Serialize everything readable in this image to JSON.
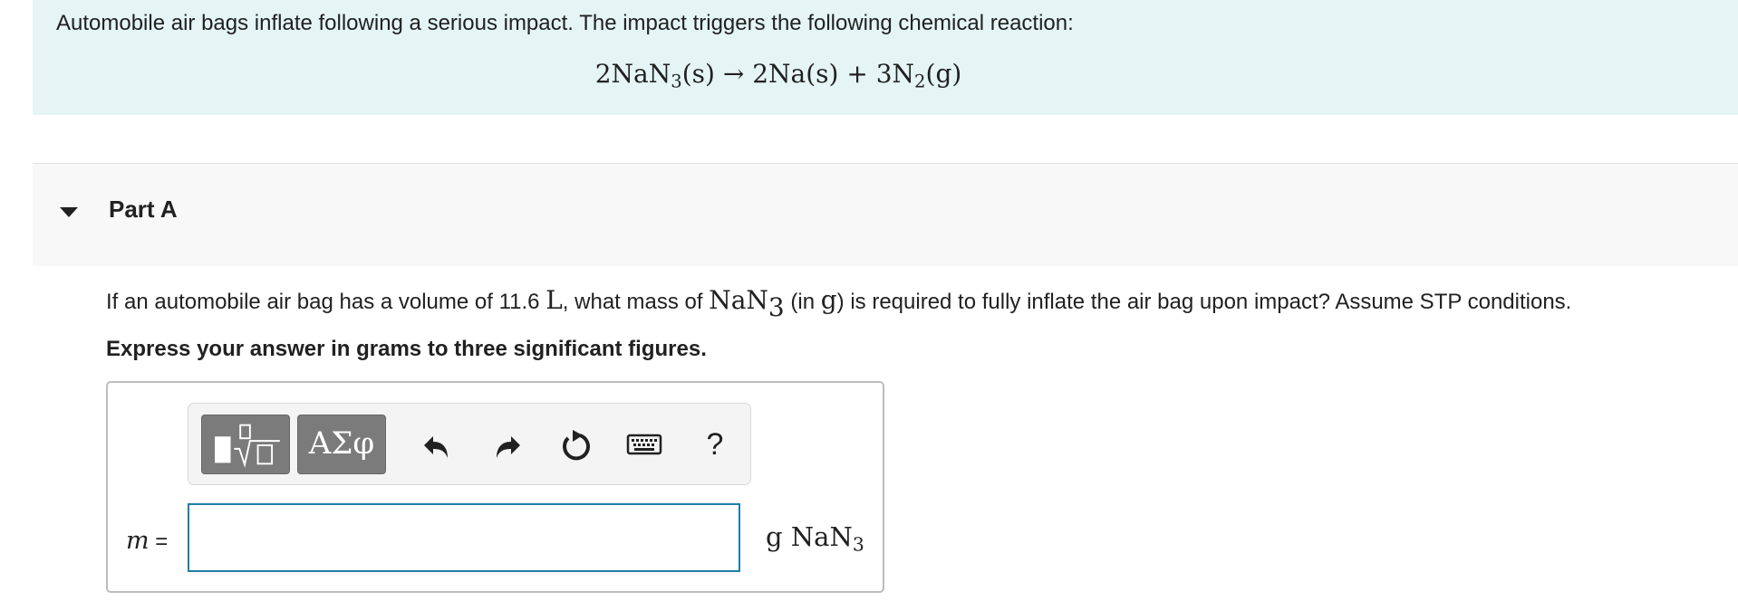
{
  "intro": {
    "text": "Automobile air bags inflate following a serious impact. The impact triggers the following chemical reaction:",
    "equation": {
      "reactant_coef": "2",
      "reactant_formula": "NaN",
      "reactant_sub": "3",
      "reactant_state": "(s)",
      "arrow": "→",
      "product1_coef": "2",
      "product1_formula": "Na",
      "product1_state": "(s)",
      "plus": "+",
      "product2_coef": "3",
      "product2_formula": "N",
      "product2_sub": "2",
      "product2_state": "(g)"
    }
  },
  "part": {
    "title": "Part A",
    "toggle_icon": "caret-down-icon"
  },
  "question": {
    "before_volume": "If an automobile air bag has a volume of 11.6 ",
    "volume_unit": "L",
    "mid": ", what mass of ",
    "compound": "NaN",
    "compound_sub": "3",
    "unit_paren_open": " (in ",
    "mass_unit": "g",
    "after": ") is required to fully inflate the air bag upon impact? Assume STP conditions.",
    "instruction": "Express your answer in grams to three significant figures."
  },
  "toolbar": {
    "templates_icon": "templates-sqrt-icon",
    "greek_label": "ΑΣφ",
    "undo_icon": "undo-icon",
    "redo_icon": "redo-icon",
    "reset_icon": "reset-icon",
    "keyboard_icon": "keyboard-icon",
    "help_label": "?"
  },
  "answer": {
    "variable": "m",
    "equals": " =",
    "value": "",
    "unit_g": "g",
    "unit_formula": "NaN",
    "unit_sub": "3"
  },
  "colors": {
    "intro_bg": "#e5f5f5",
    "part_bg": "#f8f8f8",
    "input_border": "#1f7fa6",
    "toolbar_dark_btn": "#7b7b7b"
  }
}
